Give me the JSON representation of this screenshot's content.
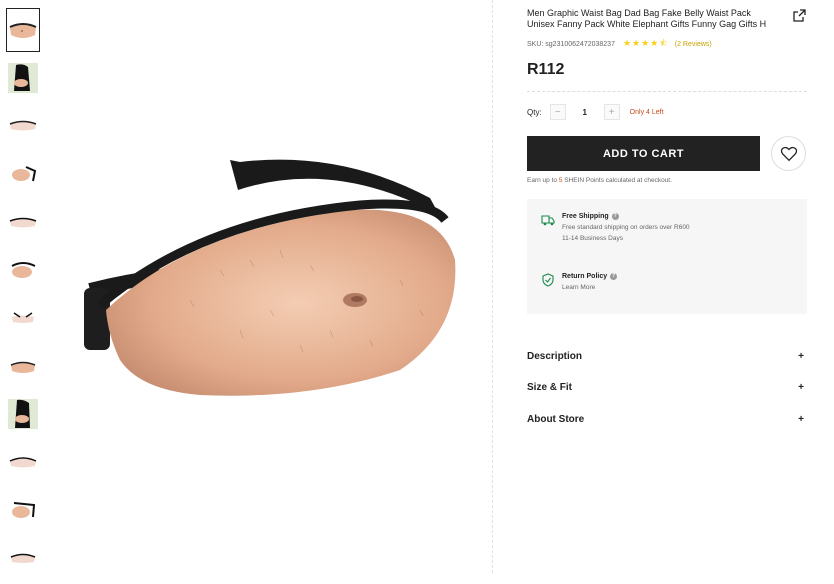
{
  "product": {
    "title": "Men Graphic Waist Bag Dad Bag Fake Belly Waist Pack Unisex Fanny Pack White Elephant Gifts Funny Gag Gifts H",
    "sku": "SKU: sg2310062472038237",
    "rating_stars": "★★★★⯪",
    "reviews": "(2 Reviews)",
    "price": "R112"
  },
  "qty": {
    "label": "Qty:",
    "value": "1",
    "minus": "−",
    "plus": "+",
    "stock_note": "Only 4 Left"
  },
  "cart": {
    "add_label": "ADD TO CART"
  },
  "points": {
    "prefix": "Earn up to ",
    "num": "5",
    "suffix": " SHEIN Points calculated at checkout."
  },
  "shipping": {
    "free_title": "Free Shipping",
    "free_line1": "Free standard shipping on orders over R600",
    "free_line2": "11-14 Business Days",
    "return_title": "Return Policy",
    "return_link": "Learn More",
    "help_glyph": "?"
  },
  "accordion": [
    {
      "label": "Description",
      "icon": "+"
    },
    {
      "label": "Size & Fit",
      "icon": "+"
    },
    {
      "label": "About Store",
      "icon": "+"
    }
  ],
  "colors": {
    "accent_red": "#c44a1b",
    "star": "#facf19",
    "button": "#222222"
  }
}
